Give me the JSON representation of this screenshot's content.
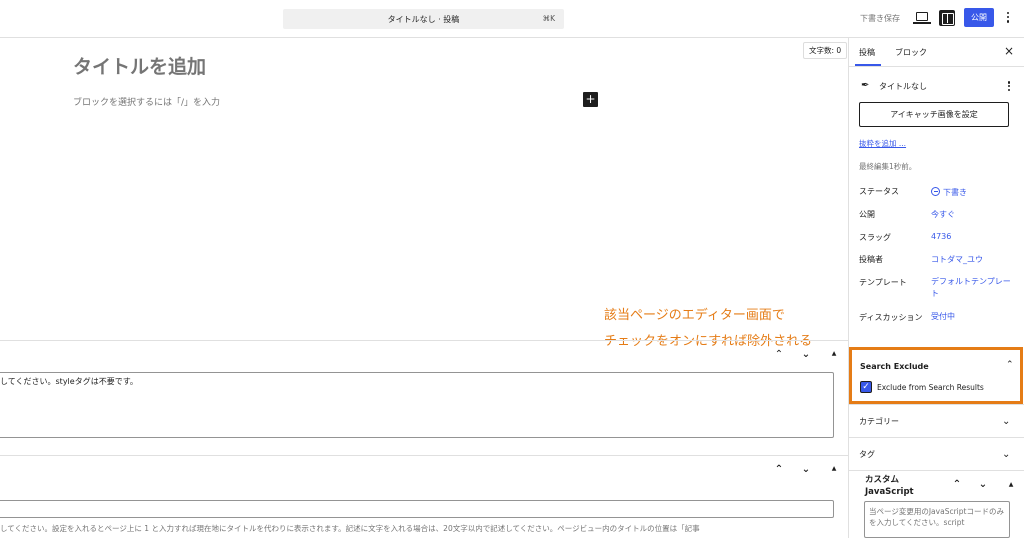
{
  "topbar": {
    "command_title": "タイトルなし · 投稿",
    "command_shortcut": "⌘K",
    "save_draft": "下書き保存",
    "publish": "公開",
    "icons": [
      "desktop-preview-icon",
      "sidebar-toggle-icon",
      "more-vertical-icon"
    ]
  },
  "editor": {
    "word_count": "文字数: 0",
    "title_placeholder": "タイトルを追加",
    "block_placeholder": "ブロックを選択するには「/」を入力",
    "add_block": "+"
  },
  "annotation": {
    "line1": "該当ページのエディター画面で",
    "line2": "チェックをオンにすれば除外される"
  },
  "metabox1": {
    "textarea_text": "してください。styleタグは不要です。"
  },
  "metabox2": {
    "description": "してください。設定を入れるとページ上に 1 と入力すれば現在地にタイトルを代わりに表示されます。記述に文字を入れる場合は、20文字以内で記述してください。ページビュー内のタイトルの位置は「記事"
  },
  "sidebar": {
    "tab_post": "投稿",
    "tab_block": "ブロック",
    "close": "×",
    "doc_title": "タイトルなし",
    "featured_image_btn": "アイキャッチ画像を設定",
    "add_excerpt": "抜粋を追加 ...",
    "last_edited": "最終編集1秒前。",
    "rows": [
      {
        "label": "ステータス",
        "value": "下書き"
      },
      {
        "label": "公開",
        "value": "今すぐ"
      },
      {
        "label": "スラッグ",
        "value": "4736"
      },
      {
        "label": "投稿者",
        "value": "コトダマ_ユウ"
      },
      {
        "label": "テンプレート",
        "value": "デフォルトテンプレート"
      },
      {
        "label": "ディスカッション",
        "value": "受付中"
      }
    ],
    "search_exclude": {
      "title": "Search Exclude",
      "checkbox_label": "Exclude from Search Results",
      "checked": true
    },
    "categories": "カテゴリー",
    "tags": "タグ",
    "custom_js": {
      "title": "カスタム JavaScript",
      "placeholder": "当ページ変更用のJavaScriptコードのみを入力してください。script"
    }
  },
  "colors": {
    "accent": "#3858e9",
    "highlight": "#e57c16"
  }
}
